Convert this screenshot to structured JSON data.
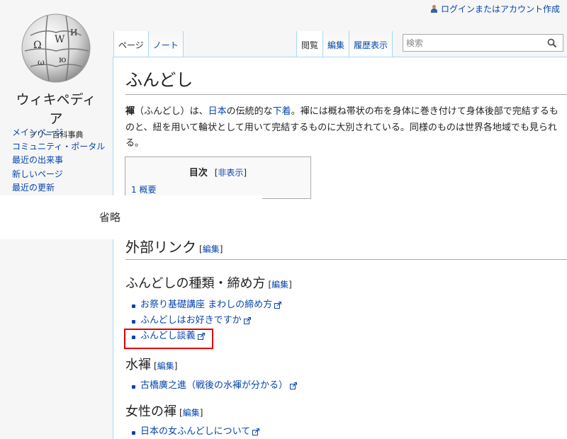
{
  "header": {
    "login_link": "ログインまたはアカウント作成"
  },
  "logo": {
    "title": "ウィキペディア",
    "subtitle": "フリー百科事典"
  },
  "nav": [
    "メインページ",
    "コミュニティ・ポータル",
    "最近の出来事",
    "新しいページ",
    "最近の更新"
  ],
  "tabs": {
    "left": [
      "ページ",
      "ノート"
    ],
    "right": [
      "閲覧",
      "編集",
      "履歴表示"
    ]
  },
  "search": {
    "placeholder": "検索"
  },
  "article": {
    "title": "ふんどし",
    "intro": {
      "bold": "褌",
      "t1": "（ふんどし）は、",
      "link1": "日本",
      "t2": "の伝統的な",
      "link2": "下着",
      "t3": "。褌には概ね帯状の布を身体に巻き付けて身体後部で完結するものと、紐を用いて輪状として用いて完結するものに大別されている。同様のものは世界各地域でも見られる。"
    },
    "toc": {
      "title": "目次",
      "toggle": "非表示",
      "first_item": "1 概要"
    },
    "omitted_note": "省略",
    "sections": {
      "external": "外部リンク",
      "kinds": "ふんどしの種類・締め方",
      "swim": "水褌",
      "women": "女性の褌"
    },
    "edit_label": "編集",
    "edit_open": "[",
    "edit_close": "]",
    "links_kinds": [
      "お祭り基礎講座 まわしの締め方",
      "ふんどしはお好きですか",
      "ふんどし談義"
    ],
    "links_swim": [
      "古橋廣之進（戦後の水褌が分かる）"
    ],
    "links_women": [
      "日本の女ふんどしについて"
    ]
  },
  "colors": {
    "link": "#0645ad",
    "tab_border": "#a7d7f9",
    "highlight": "#e00000"
  }
}
